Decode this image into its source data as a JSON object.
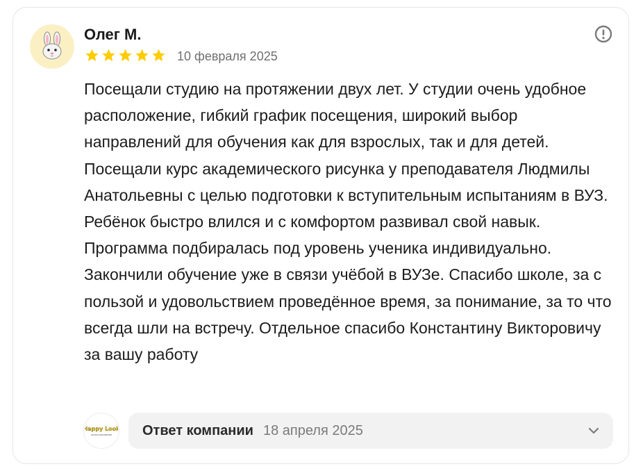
{
  "review": {
    "author": {
      "name": "Олег М.",
      "avatar_icon": "bunny-face-icon"
    },
    "rating": 5,
    "rating_max": 5,
    "star_color": "#fc0",
    "date": "10 февраля 2025",
    "text": "Посещали студию на протяжении двух лет. У студии очень удобное расположение, гибкий график посещения, широкий выбор направлений для обучения как для взрослых, так и для детей. Посещали курс академического рисунка у преподавателя Людмилы Анатольевны с целью подготовки к вступительным испытаниям в ВУЗ. Ребёнок быстро влился и с комфортом развивал свой навык. Программа подбиралась под уровень ученика индивидуально. Закончили обучение уже в связи учёбой в ВУЗе. Спасибо школе, за с пользой и удовольствием проведённое время, за понимание, за то что всегда шли на встречу. Отдельное спасибо Константину Викторовичу за вашу работу",
    "report_icon": "exclamation-circle-icon"
  },
  "company_reply": {
    "logo_text": "Happy Look",
    "logo_subtext": "школа рисования",
    "label": "Ответ компании",
    "date": "18 апреля 2025",
    "expand_icon": "chevron-down-icon"
  }
}
